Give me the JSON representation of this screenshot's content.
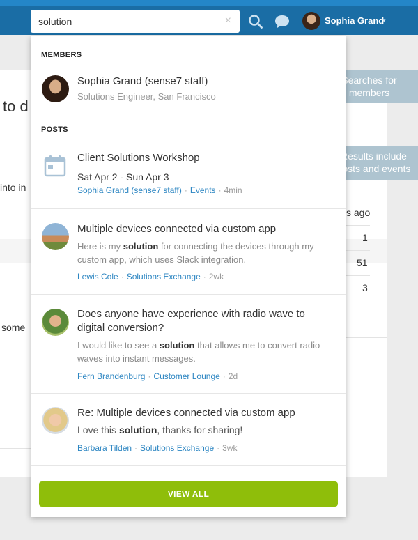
{
  "header": {
    "search_value": "solution",
    "clear_label": "×",
    "user_name": "Sophia Grand",
    "caret": "▾"
  },
  "background": {
    "frag_1": "to d",
    "frag_2": "into in",
    "frag_3": "some",
    "frag_4": "s ago",
    "count_1": "1",
    "count_2": "51",
    "count_3": "3"
  },
  "callouts": [
    {
      "text": "Searches for members"
    },
    {
      "text": "Results include posts and events"
    }
  ],
  "dropdown": {
    "members_heading": "MEMBERS",
    "posts_heading": "POSTS",
    "member": {
      "name": "Sophia Grand (sense7 staff)",
      "title": "Solutions Engineer, San Francisco"
    },
    "event": {
      "title": "Client Solutions Workshop",
      "dates": "Sat Apr 2 - Sun Apr 3",
      "author": "Sophia Grand (sense7 staff)",
      "category": "Events",
      "time": "4min"
    },
    "posts": [
      {
        "title": "Multiple devices connected via custom app",
        "body_pre": "Here is my ",
        "highlight": "solution",
        "body_post": " for connecting the devices through my custom app, which uses Slack integration.",
        "author": "Lewis Cole",
        "category": "Solutions Exchange",
        "time": "2wk"
      },
      {
        "title": "Does anyone have experience with radio wave to digital conversion?",
        "body_pre": "I would like to see a ",
        "highlight": "solution",
        "body_post": " that allows me to convert radio waves into instant messages.",
        "author": "Fern Brandenburg",
        "category": "Customer Lounge",
        "time": "2d"
      },
      {
        "title": "Re: Multiple devices connected via custom app",
        "body_pre": "Love this ",
        "highlight": "solution",
        "body_post": ", thanks for sharing!",
        "author": "Barbara Tilden",
        "category": "Solutions Exchange",
        "time": "3wk"
      }
    ],
    "separator": "·",
    "view_all": "VIEW ALL"
  }
}
